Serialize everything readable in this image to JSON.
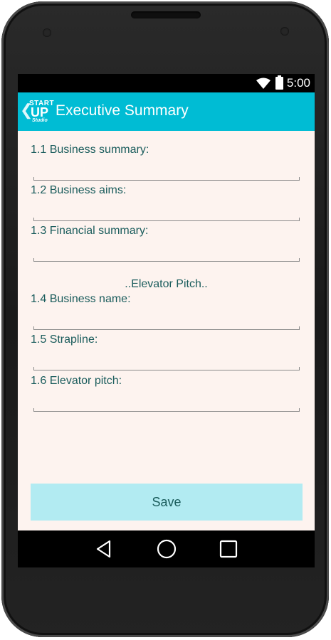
{
  "status_bar": {
    "time": "5:00"
  },
  "app_bar": {
    "logo": {
      "line1": "START",
      "line2": "UP",
      "line3": "Studio"
    },
    "title": "Executive Summary"
  },
  "form": {
    "fields": [
      {
        "label": "1.1 Business summary:",
        "value": ""
      },
      {
        "label": "1.2 Business aims:",
        "value": ""
      },
      {
        "label": "1.3 Financial summary:",
        "value": ""
      }
    ],
    "section_heading": "..Elevator Pitch..",
    "pitch_fields": [
      {
        "label": "1.4 Business name:",
        "value": ""
      },
      {
        "label": "1.5 Strapline:",
        "value": ""
      },
      {
        "label": "1.6 Elevator pitch:",
        "value": ""
      }
    ],
    "save_label": "Save"
  },
  "navigation": {
    "back": "back-icon",
    "home": "home-icon",
    "recents": "recents-icon"
  },
  "colors": {
    "app_bar": "#00bcd4",
    "background": "#fdf3ef",
    "text": "#1a5c5c",
    "button": "#b2ebf2"
  }
}
